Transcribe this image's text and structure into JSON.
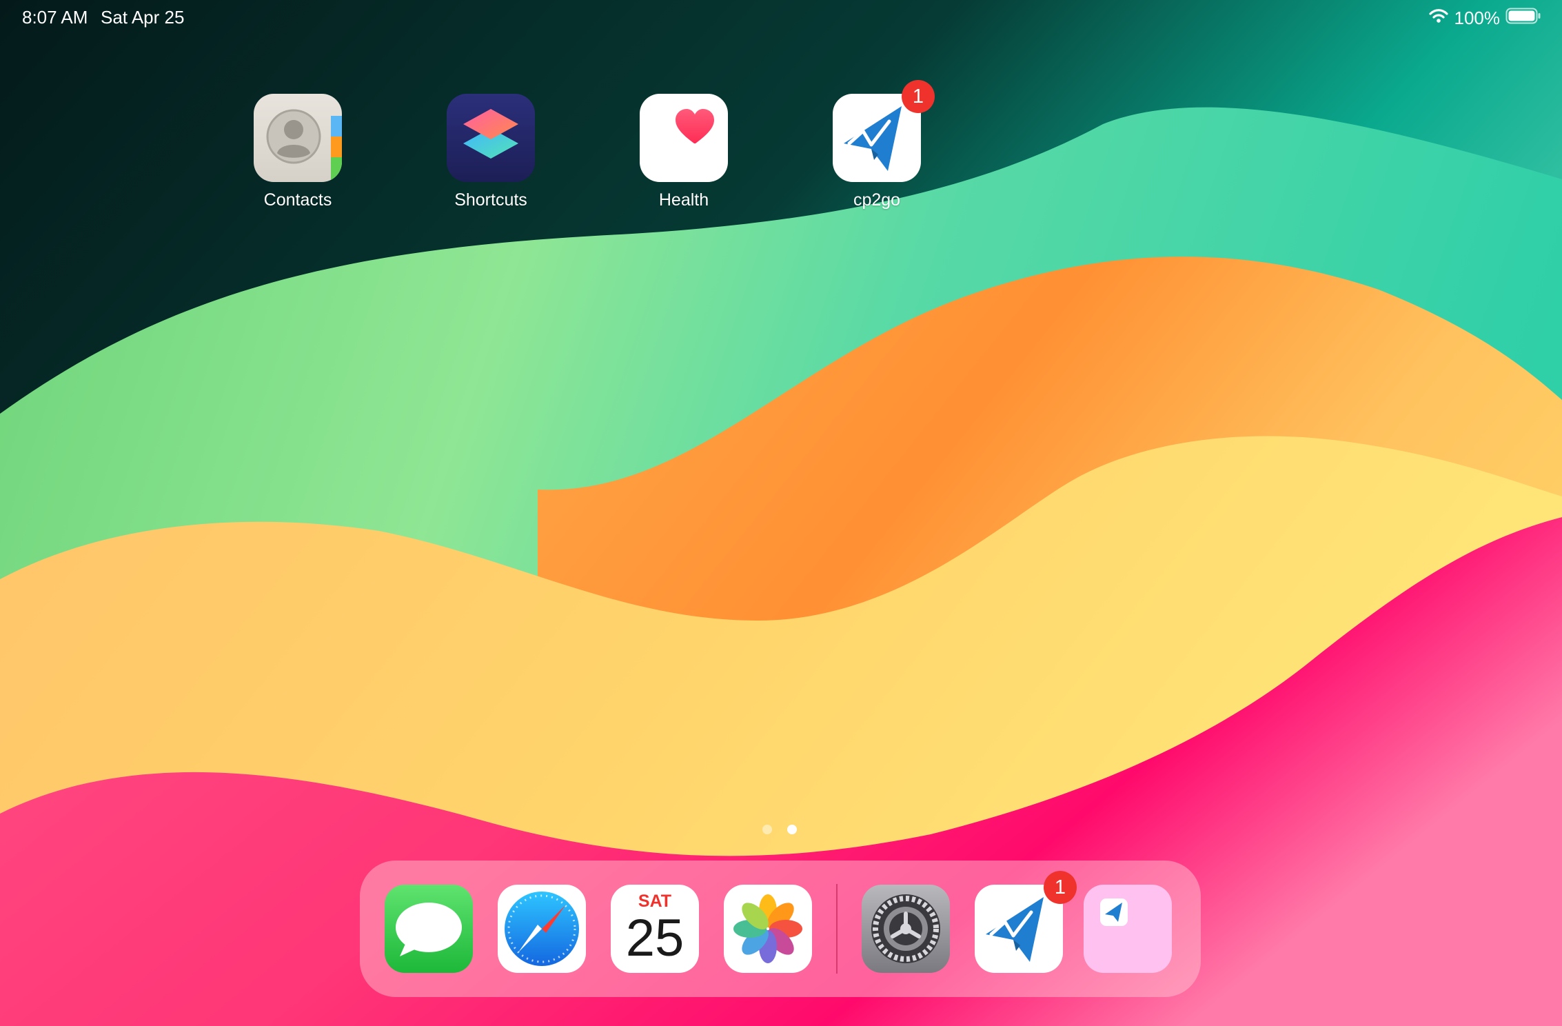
{
  "status_bar": {
    "time": "8:07 AM",
    "date": "Sat Apr 25",
    "battery": "100%",
    "icons": [
      "wifi-icon",
      "battery-icon"
    ]
  },
  "home_apps": [
    {
      "label": "Contacts",
      "icon": "contacts-icon"
    },
    {
      "label": "Shortcuts",
      "icon": "shortcuts-icon"
    },
    {
      "label": "Health",
      "icon": "health-icon"
    },
    {
      "label": "cp2go",
      "icon": "cp2go-icon",
      "badge": "1"
    }
  ],
  "dock": {
    "apps": [
      {
        "name": "Messages",
        "icon": "messages-icon"
      },
      {
        "name": "Safari",
        "icon": "safari-icon"
      },
      {
        "name": "Calendar",
        "icon": "calendar-icon",
        "day": "SAT",
        "date": "25"
      },
      {
        "name": "Photos",
        "icon": "photos-icon"
      },
      {
        "name": "Settings",
        "icon": "settings-icon"
      },
      {
        "name": "cp2go",
        "icon": "cp2go-icon",
        "badge": "1"
      },
      {
        "name": "App Library",
        "icon": "app-library-icon"
      }
    ]
  },
  "page_dots": {
    "count": 2,
    "active": 2
  },
  "colors": {
    "badge": "#f0322d",
    "cp2go_blue": "#1f7ed0",
    "messages_green": "#34c759",
    "calendar_red": "#f0322d",
    "wallpaper_dark": "#05302d",
    "wallpaper_green": "#7fe29a",
    "wallpaper_orange": "#ff9a3c",
    "wallpaper_yellow": "#ffdc6a",
    "wallpaper_pink": "#ff2f7a"
  }
}
